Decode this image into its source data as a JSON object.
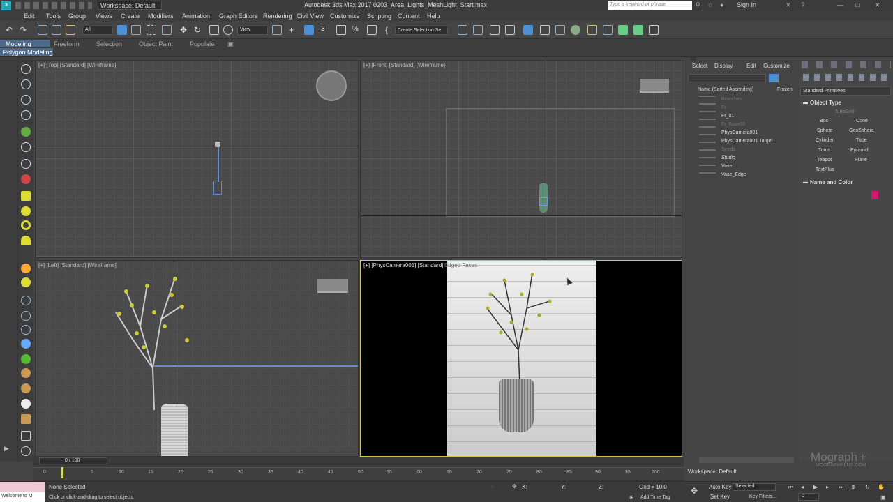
{
  "titlebar": {
    "workspace": "Workspace: Default",
    "app_title": "Autodesk 3ds Max 2017     0203_Area_Lights_MeshLight_Start.max",
    "search_placeholder": "Type a keyword or phrase",
    "sign_in": "Sign In"
  },
  "menu": [
    "Edit",
    "Tools",
    "Group",
    "Views",
    "Create",
    "Modifiers",
    "Animation",
    "Graph Editors",
    "Rendering",
    "Civil View",
    "Customize",
    "Scripting",
    "Content",
    "Help"
  ],
  "toolbar": {
    "filter": "All",
    "view_dropdown": "View",
    "selection_set": "Create Selection Se"
  },
  "ribbon": {
    "tabs": [
      "Modeling",
      "Freeform",
      "Selection",
      "Object Paint",
      "Populate"
    ],
    "sub": "Polygon Modeling"
  },
  "viewports": {
    "top": "[+] [Top] [Standard] [Wireframe]",
    "front": "[+] [Front] [Standard] [Wireframe]",
    "left": "[+] [Left] [Standard] [Wireframe]",
    "camera_prefix": "[+] [PhysCamera001] [Standard]",
    "camera_mode": "Edged Faces"
  },
  "scene_explorer": {
    "tabs": [
      "Select",
      "Display",
      "Edit",
      "Customize"
    ],
    "header": "Name (Sorted Ascending)",
    "frozen": "Frozen",
    "items": [
      "Branches",
      "Fr",
      "Fr_01",
      "Fr_Base00",
      "PhysCamera001",
      "PhysCamera001.Target",
      "Seeds",
      "Studio",
      "Vase",
      "Vase_Edge"
    ],
    "workspace": "Workspace: Default"
  },
  "command_panel": {
    "dropdown": "Standard Primitives",
    "object_type": "Object Type",
    "autogrid": "AutoGrid",
    "buttons": [
      "Box",
      "Cone",
      "Sphere",
      "GeoSphere",
      "Cylinder",
      "Tube",
      "Torus",
      "Pyramid",
      "Teapot",
      "Plane",
      "TextPlus"
    ],
    "name_and_color": "Name and Color",
    "swatch_color": "#d01870"
  },
  "timeline": {
    "frame": "0 / 100",
    "ticks": [
      "0",
      "5",
      "10",
      "15",
      "20",
      "25",
      "30",
      "35",
      "40",
      "45",
      "50",
      "55",
      "60",
      "65",
      "70",
      "75",
      "80",
      "85",
      "90",
      "95",
      "100"
    ]
  },
  "status": {
    "maxscript": "Welcome to M",
    "selection": "None Selected",
    "prompt": "Click or click-and-drag to select objects",
    "x_label": "X:",
    "y_label": "Y:",
    "z_label": "Z:",
    "grid": "Grid = 10.0",
    "add_time_tag": "Add Time Tag",
    "auto_key": "Auto Key",
    "set_key": "Set Key",
    "selected": "Selected",
    "key_filters": "Key Filters...",
    "frame_field": "0"
  },
  "watermark": "Mograph",
  "watermark_sub": "MOGRAPHPLUS.COM"
}
